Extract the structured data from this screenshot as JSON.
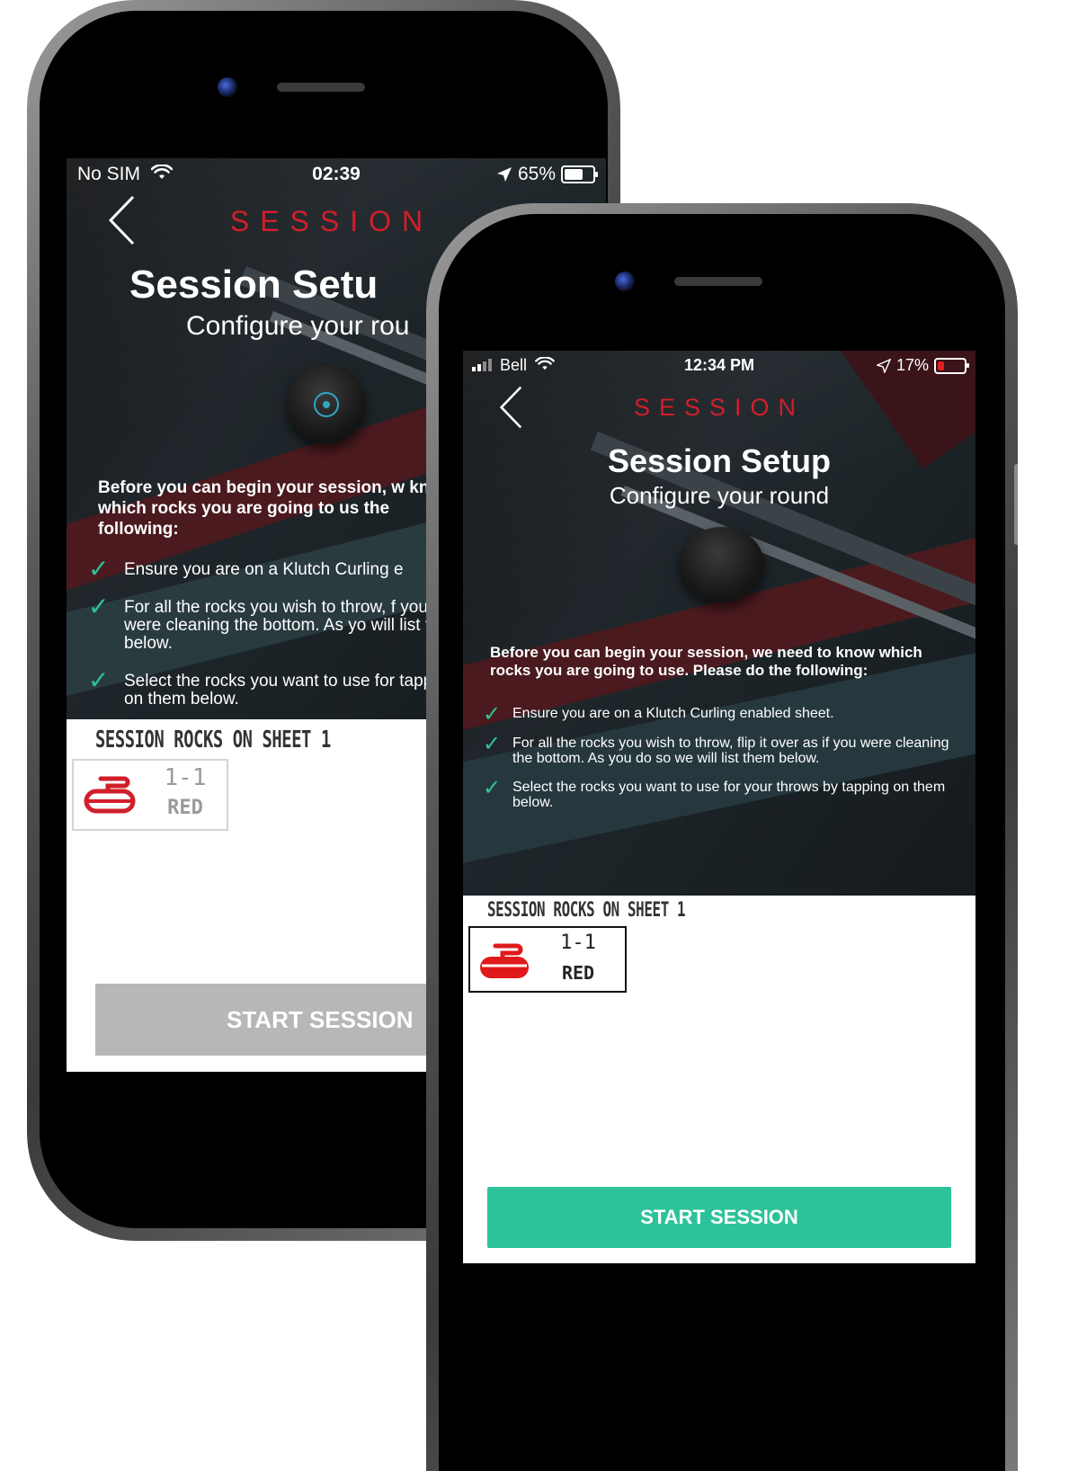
{
  "colors": {
    "accent_red": "#d11f2a",
    "check_green": "#2ec29a",
    "start_active": "#2ec29a",
    "start_disabled": "#b7b7b7",
    "puck_ring": "#2ea8c0"
  },
  "phone_back": {
    "status": {
      "carrier": "No SIM",
      "time": "02:39",
      "battery": "65%"
    },
    "nav": {
      "back_icon": "chevron-left-icon",
      "label": "SESSION"
    },
    "title": "Session Setu",
    "subtitle": "Configure your rou",
    "intro": "Before you can begin your session, w know which rocks you are going to us the following:",
    "steps": [
      "Ensure you are on a Klutch Curling e",
      "For all the rocks you wish to throw, f you were cleaning the bottom. As yo will list them below.",
      "Select the rocks you want to use for tapping on them below."
    ],
    "rocks_heading": "SESSION ROCKS ON SHEET 1",
    "rock": {
      "number": "1-1",
      "color": "RED"
    },
    "start_label": "START SESSION"
  },
  "phone_front": {
    "status": {
      "carrier": "Bell",
      "time": "12:34 PM",
      "battery": "17%"
    },
    "nav": {
      "back_icon": "chevron-left-icon",
      "label": "SESSION"
    },
    "title": "Session Setup",
    "subtitle": "Configure your round",
    "intro": "Before you can begin your session, we need to know which rocks you are going to use. Please do the following:",
    "steps": [
      "Ensure you are on a Klutch Curling enabled sheet.",
      "For all the rocks you wish to throw, flip it over as if you were cleaning the bottom. As you do so we will list them below.",
      "Select the rocks you want to use for your throws by tapping on them below."
    ],
    "rocks_heading": "SESSION ROCKS ON SHEET 1",
    "rock": {
      "number": "1-1",
      "color": "RED"
    },
    "start_label": "START SESSION"
  }
}
